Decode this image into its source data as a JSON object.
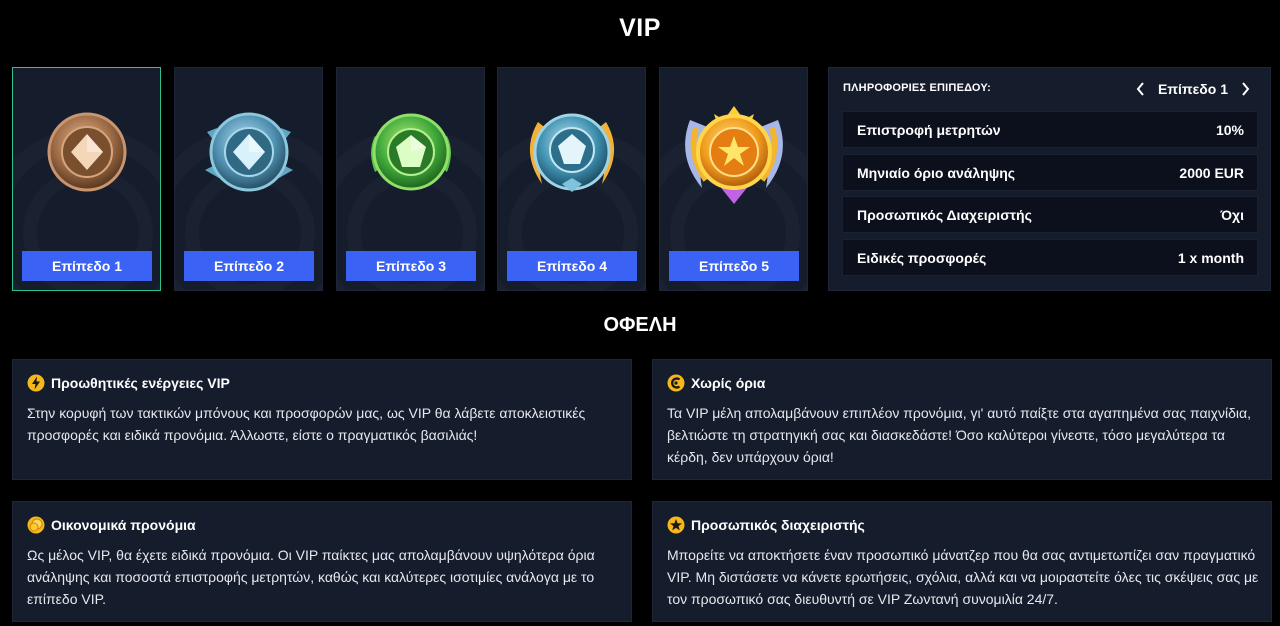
{
  "page": {
    "title": "VIP",
    "benefits_title": "ΟΦΕΛΗ"
  },
  "levels": [
    {
      "label": "Επίπεδο 1",
      "medal": "bronze-medal-icon",
      "color": "#9b6a45"
    },
    {
      "label": "Επίπεδο 2",
      "medal": "steel-blue-medal-icon",
      "color": "#4f8fb0"
    },
    {
      "label": "Επίπεδο 3",
      "medal": "emerald-medal-icon",
      "color": "#3fa83a"
    },
    {
      "label": "Επίπεδο 4",
      "medal": "winged-blue-medal-icon",
      "color": "#3d8fae"
    },
    {
      "label": "Επίπεδο 5",
      "medal": "golden-star-medal-icon",
      "color": "#f09a1c"
    }
  ],
  "info": {
    "heading": "ΠΛΗΡΟΦΟΡΙΕΣ ΕΠΙΠΕΔΟΥ:",
    "current_level": "Επίπεδο 1",
    "rows": [
      {
        "label": "Επιστροφή μετρητών",
        "value": "10%"
      },
      {
        "label": "Μηνιαίο όριο ανάληψης",
        "value": "2000 EUR"
      },
      {
        "label": "Προσωπικός Διαχειριστής",
        "value": "Όχι"
      },
      {
        "label": "Ειδικές προσφορές",
        "value": "1 x month"
      }
    ]
  },
  "benefits": [
    {
      "title": "Προωθητικές ενέργειες VIP",
      "icon": "lightning-icon",
      "text": "Στην κορυφή των τακτικών μπόνους και προσφορών μας, ως VIP θα λάβετε αποκλειστικές προσφορές και ειδικά προνόμια. Άλλωστε, είστε ο πραγματικός βασιλιάς!"
    },
    {
      "title": "Χωρίς όρια",
      "icon": "no-limit-icon",
      "text": "Τα VIP μέλη απολαμβάνουν επιπλέον προνόμια, γι' αυτό παίξτε στα αγαπημένα σας παιχνίδια, βελτιώστε τη στρατηγική σας και διασκεδάστε! Όσο καλύτεροι γίνεστε, τόσο μεγαλύτερα τα κέρδη, δεν υπάρχουν όρια!"
    },
    {
      "title": "Οικονομικά προνόμια",
      "icon": "coin-icon",
      "text": "Ως μέλος VIP, θα έχετε ειδικά προνόμια. Οι VIP παίκτες μας απολαμβάνουν υψηλότερα όρια ανάληψης και ποσοστά επιστροφής μετρητών, καθώς και καλύτερες ισοτιμίες ανάλογα με το επίπεδο VIP."
    },
    {
      "title": "Προσωπικός διαχειριστής",
      "icon": "star-icon",
      "text": "Μπορείτε να αποκτήσετε έναν προσωπικό μάνατζερ που θα σας αντιμετωπίζει σαν πραγματικό VIP. Μη διστάσετε να κάνετε ερωτήσεις, σχόλια, αλλά και να μοιραστείτε όλες τις σκέψεις σας με τον προσωπικό σας διευθυντή σε VIP Ζωντανή συνομιλία 24/7."
    }
  ],
  "colors": {
    "accent": "#3a63f5",
    "active_border": "#2fbf8a",
    "card_bg": "#151c2c",
    "row_bg": "#0b101c"
  }
}
